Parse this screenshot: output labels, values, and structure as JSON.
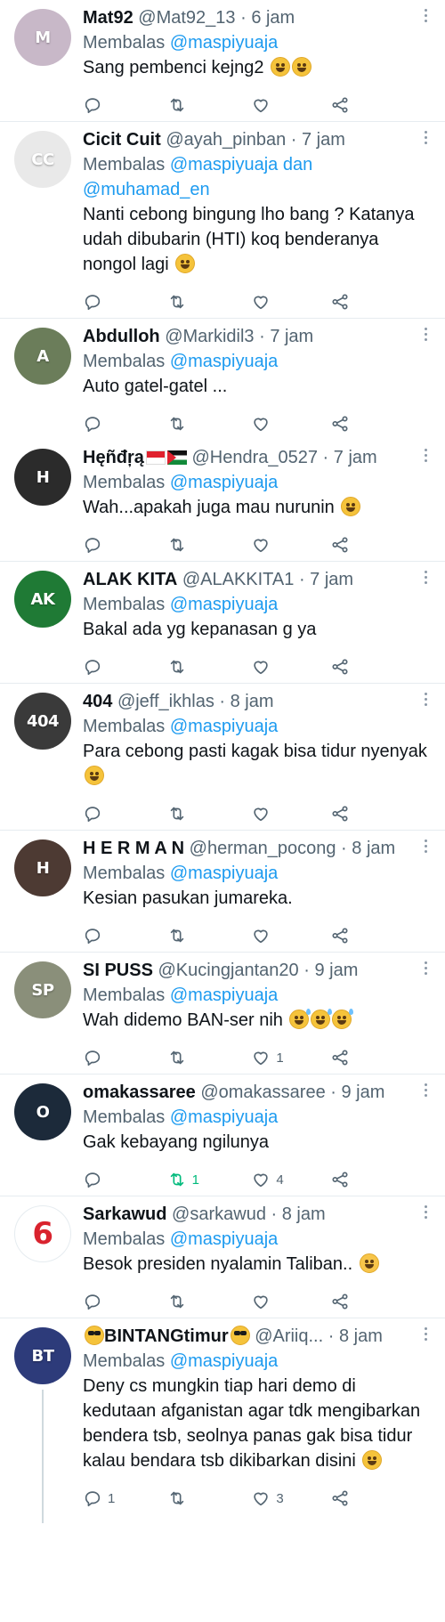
{
  "colors": {
    "accent": "#1d9bf0",
    "muted": "#536471",
    "retweet_active": "#00ba7c",
    "divider": "#e6ecf0"
  },
  "replying_prefix": "Membalas",
  "tweets": [
    {
      "name": "Mat92",
      "handle": "@Mat92_13",
      "time": "6 jam",
      "mentions": [
        "@maspiyuaja"
      ],
      "joiner": "",
      "text": "Sang pembenci kejng2",
      "emojis": [
        "laugh",
        "laugh"
      ],
      "avatar": {
        "bg": "#c8b8c8",
        "label": "M"
      },
      "stats": {
        "reply": "",
        "retweet": "",
        "like": ""
      },
      "retweet_active": false
    },
    {
      "name": "Cicit Cuit",
      "handle": "@ayah_pinban",
      "time": "7 jam",
      "mentions": [
        "@maspiyuaja",
        "@muhamad_en"
      ],
      "joiner": "dan",
      "text": "Nanti cebong bingung lho bang ? Katanya udah dibubarin (HTI) koq benderanya nongol lagi",
      "emojis": [
        "grin"
      ],
      "avatar": {
        "bg": "#e9e9e9",
        "label": "CC"
      },
      "stats": {
        "reply": "",
        "retweet": "",
        "like": ""
      },
      "retweet_active": false
    },
    {
      "name": "Abdulloh",
      "handle": "@Markidil3",
      "time": "7 jam",
      "mentions": [
        "@maspiyuaja"
      ],
      "joiner": "",
      "text": "Auto gatel-gatel ...",
      "emojis": [],
      "avatar": {
        "bg": "#6b7d5a",
        "label": "A"
      },
      "stats": {
        "reply": "",
        "retweet": "",
        "like": ""
      },
      "retweet_active": false,
      "no_divider": true
    },
    {
      "name": "Hęñđŗą",
      "handle": "@Hendra_0527",
      "time": "7 jam",
      "mentions": [
        "@maspiyuaja"
      ],
      "joiner": "",
      "text": "Wah...apakah juga mau nurunin",
      "emojis": [
        "rofl"
      ],
      "name_flags": [
        "id",
        "ps"
      ],
      "avatar": {
        "bg": "#2b2b2b",
        "label": "H"
      },
      "stats": {
        "reply": "",
        "retweet": "",
        "like": ""
      },
      "retweet_active": false
    },
    {
      "name": "ALAK KITA",
      "handle": "@ALAKKITA1",
      "time": "7 jam",
      "mentions": [
        "@maspiyuaja"
      ],
      "joiner": "",
      "text": "Bakal ada yg kepanasan g ya",
      "emojis": [],
      "avatar": {
        "bg": "#1f7a35",
        "label": "AK"
      },
      "stats": {
        "reply": "",
        "retweet": "",
        "like": ""
      },
      "retweet_active": false
    },
    {
      "name": "404",
      "handle": "@jeff_ikhlas",
      "time": "8 jam",
      "mentions": [
        "@maspiyuaja"
      ],
      "joiner": "",
      "text": "Para cebong pasti kagak bisa tidur nyenyak",
      "emojis": [
        "rofl"
      ],
      "avatar": {
        "bg": "#3a3a3a",
        "label": "404"
      },
      "stats": {
        "reply": "",
        "retweet": "",
        "like": ""
      },
      "retweet_active": false
    },
    {
      "name": "H E R M A N",
      "handle": "@herman_pocong",
      "time": "8 jam",
      "mentions": [
        "@maspiyuaja"
      ],
      "joiner": "",
      "text": "Kesian pasukan jumareka.",
      "emojis": [],
      "avatar": {
        "bg": "#4d3a33",
        "label": "H"
      },
      "stats": {
        "reply": "",
        "retweet": "",
        "like": ""
      },
      "retweet_active": false
    },
    {
      "name": "SI PUSS",
      "handle": "@Kucingjantan20",
      "time": "9 jam",
      "mentions": [
        "@maspiyuaja"
      ],
      "joiner": "",
      "text": "Wah didemo BAN-ser nih",
      "emojis": [
        "sweat",
        "sweat",
        "sweat"
      ],
      "avatar": {
        "bg": "#8a8f7a",
        "label": "SP"
      },
      "stats": {
        "reply": "",
        "retweet": "",
        "like": "1"
      },
      "retweet_active": false
    },
    {
      "name": "omakassaree",
      "handle": "@omakassaree",
      "time": "9 jam",
      "mentions": [
        "@maspiyuaja"
      ],
      "joiner": "",
      "text": "Gak kebayang ngilunya",
      "emojis": [],
      "avatar": {
        "bg": "#1c2a3a",
        "label": "O"
      },
      "stats": {
        "reply": "",
        "retweet": "1",
        "like": "4"
      },
      "retweet_active": true
    },
    {
      "name": "Sarkawud",
      "handle": "@sarkawud",
      "time": "8 jam",
      "mentions": [
        "@maspiyuaja"
      ],
      "joiner": "",
      "text": "Besok presiden nyalamin Taliban..",
      "emojis": [
        "blush"
      ],
      "avatar": {
        "bg": "#ffffff",
        "label": "6"
      },
      "stats": {
        "reply": "",
        "retweet": "",
        "like": ""
      },
      "retweet_active": false
    },
    {
      "name": "BINTANGtimur",
      "handle": "@Ariiq...",
      "time": "8 jam",
      "mentions": [
        "@maspiyuaja"
      ],
      "joiner": "",
      "text": "Deny cs mungkin tiap hari demo di kedutaan afganistan agar tdk mengibarkan bendera tsb, seolnya panas gak bisa tidur kalau bendara tsb dikibarkan disini",
      "emojis": [
        "grin"
      ],
      "name_emoji_before": "cool",
      "name_emoji_after": "cool",
      "avatar": {
        "bg": "#2d3b7a",
        "label": "BT"
      },
      "stats": {
        "reply": "1",
        "retweet": "",
        "like": "3"
      },
      "retweet_active": false,
      "thread": true
    }
  ]
}
